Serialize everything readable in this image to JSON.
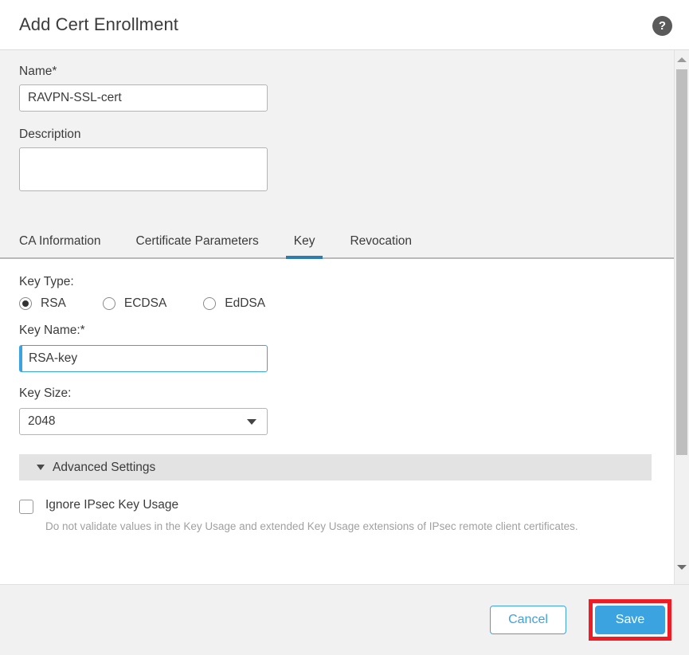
{
  "dialog": {
    "title": "Add Cert Enrollment",
    "help_icon": "help-circle-icon",
    "help_glyph": "?"
  },
  "form": {
    "name": {
      "label": "Name*",
      "value": "RAVPN-SSL-cert",
      "placeholder": ""
    },
    "description": {
      "label": "Description",
      "value": "",
      "placeholder": ""
    }
  },
  "tabs": [
    {
      "label": "CA Information",
      "active": false
    },
    {
      "label": "Certificate Parameters",
      "active": false
    },
    {
      "label": "Key",
      "active": true
    },
    {
      "label": "Revocation",
      "active": false
    }
  ],
  "key_tab": {
    "key_type": {
      "label": "Key Type:",
      "options": [
        {
          "label": "RSA",
          "selected": true
        },
        {
          "label": "ECDSA",
          "selected": false
        },
        {
          "label": "EdDSA",
          "selected": false
        }
      ]
    },
    "key_name": {
      "label": "Key Name:*",
      "value": "RSA-key",
      "placeholder": "",
      "focused": true
    },
    "key_size": {
      "label": "Key Size:",
      "value": "2048",
      "caret_icon": "chevron-down-icon"
    },
    "advanced_settings": {
      "label": "Advanced Settings",
      "expanded": true,
      "caret_icon": "triangle-down-icon"
    },
    "ignore_ipsec": {
      "label": "Ignore IPsec Key Usage",
      "checked": false,
      "description": "Do not validate values in the Key Usage and extended Key Usage extensions of IPsec remote client certificates."
    }
  },
  "footer": {
    "cancel_label": "Cancel",
    "save_label": "Save",
    "save_highlighted": true
  },
  "scrollbar": {
    "up_icon": "triangle-up-icon",
    "down_icon": "triangle-down-icon"
  },
  "colors": {
    "accent_blue": "#3ba3e0",
    "tab_active_blue": "#2d7cb0",
    "highlight_red": "#ee1c25",
    "panel_gray": "#f2f2f2",
    "section_gray": "#e3e3e3"
  }
}
